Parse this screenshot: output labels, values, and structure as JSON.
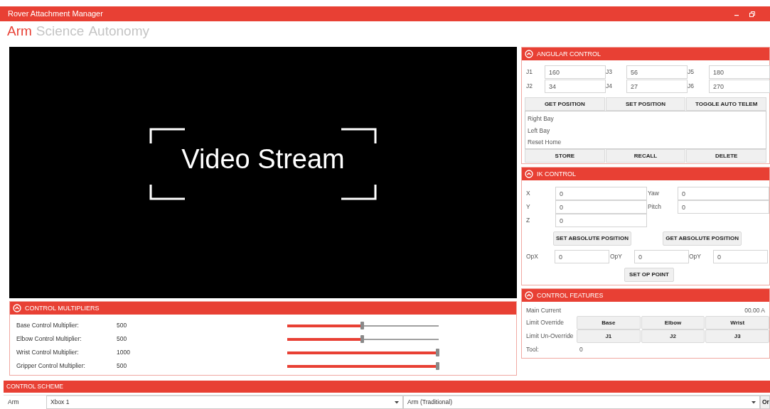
{
  "window": {
    "title": "Rover Attachment Manager"
  },
  "tabs": [
    {
      "label": "Arm",
      "selected": true
    },
    {
      "label": "Science",
      "selected": false
    },
    {
      "label": "Autonomy",
      "selected": false
    }
  ],
  "video": {
    "label": "Video Stream"
  },
  "control_multipliers": {
    "title": "CONTROL MULTIPLIERS",
    "rows": [
      {
        "label": "Base Control Multiplier:",
        "value": "500",
        "level": 0.5
      },
      {
        "label": "Elbow Control Multiplier:",
        "value": "500",
        "level": 0.5
      },
      {
        "label": "Wrist Control Multiplier:",
        "value": "1000",
        "level": 1
      },
      {
        "label": "Gripper Control Multiplier:",
        "value": "500",
        "level": 1
      }
    ]
  },
  "angular_control": {
    "title": "ANGULAR CONTROL",
    "joints": [
      {
        "label": "J1",
        "value": "160"
      },
      {
        "label": "J3",
        "value": "56"
      },
      {
        "label": "J5",
        "value": "180"
      },
      {
        "label": "J2",
        "value": "34"
      },
      {
        "label": "J4",
        "value": "27"
      },
      {
        "label": "J6",
        "value": "270"
      }
    ],
    "buttons": [
      "GET POSITION",
      "SET POSITION",
      "TOGGLE AUTO TELEM"
    ],
    "positions": [
      "Right Bay",
      "Left Bay",
      "Reset Home"
    ],
    "list_buttons": [
      "STORE",
      "RECALL",
      "DELETE"
    ]
  },
  "ik_control": {
    "title": "IK CONTROL",
    "fields": [
      {
        "label": "X",
        "value": "0"
      },
      {
        "label": "Yaw",
        "value": "0"
      },
      {
        "label": "Y",
        "value": "0"
      },
      {
        "label": "Pitch",
        "value": "0"
      },
      {
        "label": "Z",
        "value": "0"
      }
    ],
    "buttons": [
      "SET ABSOLUTE POSITION",
      "GET ABSOLUTE POSITION"
    ],
    "op_fields": [
      {
        "label": "OpX",
        "value": "0"
      },
      {
        "label": "OpY",
        "value": "0"
      },
      {
        "label": "OpY",
        "value": "0"
      }
    ],
    "op_button": "SET OP POINT"
  },
  "control_features": {
    "title": "CONTROL FEATURES",
    "main_current_label": "Main Current",
    "main_current": "00.00 A",
    "rows": [
      {
        "label": "Limit Override",
        "buttons": [
          "Base",
          "Elbow",
          "Wrist"
        ]
      },
      {
        "label": "Limit Un-Override",
        "buttons": [
          "J1",
          "J2",
          "J3"
        ]
      }
    ],
    "tool_label": "Tool:",
    "tool_value": "0"
  },
  "control_scheme": {
    "title": "CONTROL SCHEME",
    "row_label": "Arm",
    "controller": "Xbox 1",
    "mode": "Arm (Traditional)",
    "edge_button": "Or"
  }
}
